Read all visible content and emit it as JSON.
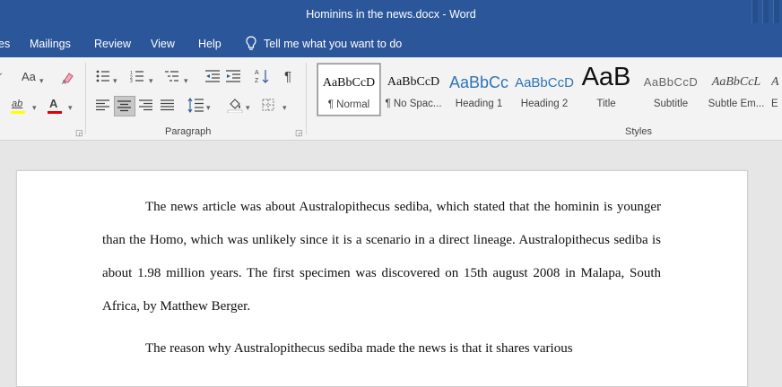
{
  "window": {
    "title": "Hominins in the news.docx  -  Word"
  },
  "menu": {
    "tabs": [
      "es",
      "Mailings",
      "Review",
      "View",
      "Help"
    ],
    "tell_me": "Tell me what you want to do"
  },
  "ribbon": {
    "groups": {
      "paragraph": "Paragraph",
      "styles": "Styles"
    },
    "font_buttons": {
      "change_case": "Aa",
      "highlight_letter": "ab",
      "font_color_letter": "A",
      "highlight_color": "#ffff00",
      "font_color": "#e00000"
    },
    "styles": [
      {
        "preview": "AaBbCcD",
        "name": "¶ Normal",
        "selected": true
      },
      {
        "preview": "AaBbCcD",
        "name": "¶ No Spac..."
      },
      {
        "preview": "AaBbCc",
        "name": "Heading 1"
      },
      {
        "preview": "AaBbCcD",
        "name": "Heading 2"
      },
      {
        "preview": "AaB",
        "name": "Title"
      },
      {
        "preview": "AaBbCcD",
        "name": "Subtitle"
      },
      {
        "preview": "AaBbCcL",
        "name": "Subtle Em..."
      },
      {
        "preview": "A",
        "name": "E"
      }
    ]
  },
  "document": {
    "paragraphs": [
      "The news article was about Australopithecus sediba, which stated that the hominin is younger than the Homo, which was unlikely since it is a scenario in a direct lineage. Australopithecus sediba is about 1.98 million years. The first specimen was discovered on 15th august 2008 in Malapa, South Africa, by Matthew Berger.",
      "The reason why Australopithecus sediba made the news is that it shares various"
    ]
  }
}
